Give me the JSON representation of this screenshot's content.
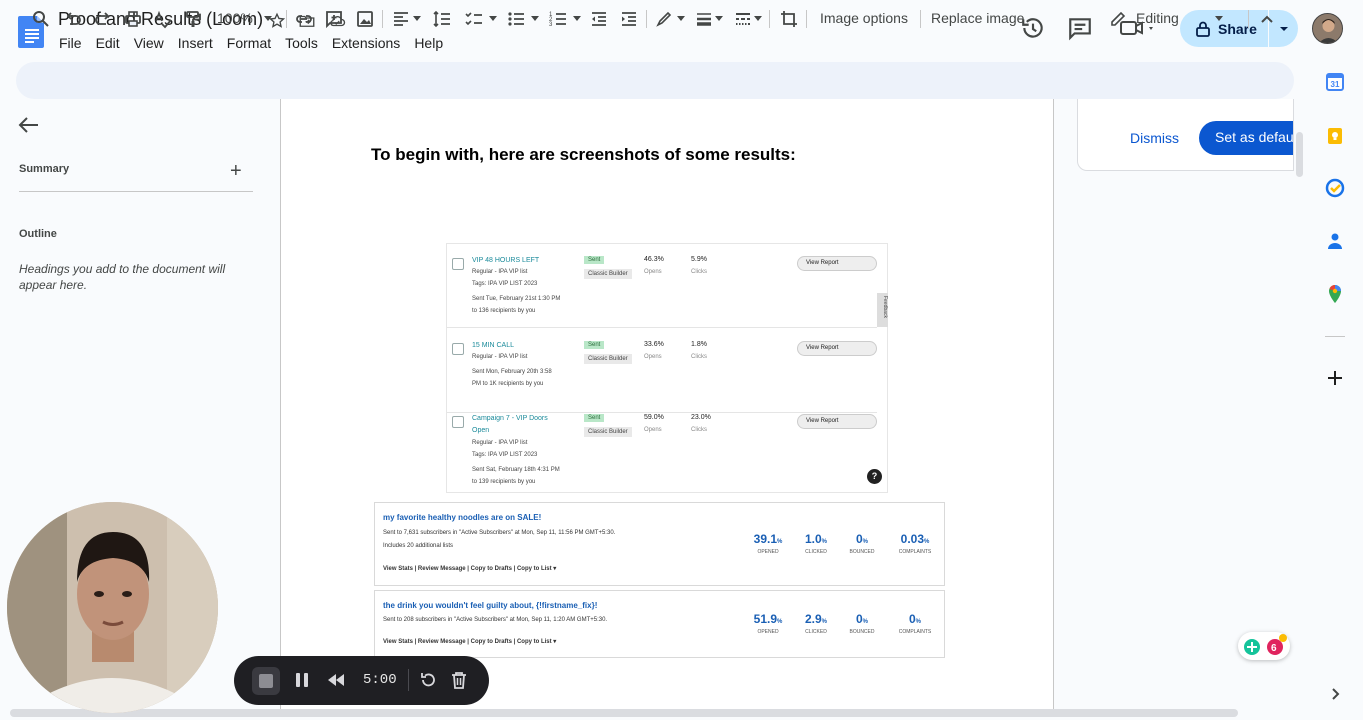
{
  "window": {
    "doc_title": "Proof and Results (Loom)"
  },
  "menu": [
    "File",
    "Edit",
    "View",
    "Insert",
    "Format",
    "Tools",
    "Extensions",
    "Help"
  ],
  "header": {
    "share_label": "Share"
  },
  "toolbar": {
    "zoom": "100%",
    "image_options_label": "Image options",
    "replace_image_label": "Replace image",
    "mode_label": "Editing"
  },
  "left_panel": {
    "summary_label": "Summary",
    "outline_label": "Outline",
    "outline_hint": "Headings you add to the document will appear here."
  },
  "document": {
    "heading": "To begin with, here are screenshots of some results:"
  },
  "campaign_report": {
    "campaigns": [
      {
        "title": "VIP 48 HOURS LEFT",
        "lines": [
          "Regular - IPA VIP list",
          "Tags: IPA VIP LIST 2023",
          "Sent Tue, February 21st 1:30 PM",
          "to 136 recipients by you"
        ],
        "status": "Sent",
        "builder": "Classic Builder",
        "opens": "46.3%",
        "opens_label": "Opens",
        "clicks": "5.9%",
        "clicks_label": "Clicks",
        "button": "View Report"
      },
      {
        "title": "15 MIN CALL",
        "lines": [
          "Regular - IPA VIP list",
          "Sent Mon, February 20th 3:58",
          "PM to 1K recipients by you"
        ],
        "status": "Sent",
        "builder": "Classic Builder",
        "opens": "33.6%",
        "opens_label": "Opens",
        "clicks": "1.8%",
        "clicks_label": "Clicks",
        "button": "View Report"
      },
      {
        "title": "Campaign 7 - VIP Doors",
        "title2": "Open",
        "lines": [
          "Regular - IPA VIP list",
          "Tags: IPA VIP LIST 2023",
          "Sent Sat, February 18th 4:31 PM",
          "to 139 recipients by you"
        ],
        "status": "Sent",
        "builder": "Classic Builder",
        "opens": "59.0%",
        "opens_label": "Opens",
        "clicks": "23.0%",
        "clicks_label": "Clicks",
        "button": "View Report"
      }
    ],
    "feedback_label": "Feedback",
    "help_symbol": "?"
  },
  "mail_stats": [
    {
      "subject": "my favorite healthy noodles are on SALE!",
      "sent_line": "Sent to 7,631 subscribers in \"Active Subscribers\" at Mon, Sep 11, 11:56 PM GMT+5:30.",
      "includes_line": "Includes 20 additional lists",
      "links": "View Stats  |  Review Message  |  Copy to Drafts  |  Copy to List ▾",
      "stats": [
        {
          "value": "39.1",
          "unit": "%",
          "label": "OPENED"
        },
        {
          "value": "1.0",
          "unit": "%",
          "label": "CLICKED"
        },
        {
          "value": "0",
          "unit": "%",
          "label": "BOUNCED"
        },
        {
          "value": "0.03",
          "unit": "%",
          "label": "COMPLAINTS"
        }
      ]
    },
    {
      "subject": "the drink you wouldn't feel guilty about, {!firstname_fix}!",
      "sent_line": "Sent to 208 subscribers in \"Active Subscribers\" at Mon, Sep 11, 1:20 AM GMT+5:30.",
      "links": "View Stats  |  Review Message  |  Copy to Drafts  |  Copy to List ▾",
      "stats": [
        {
          "value": "51.9",
          "unit": "%",
          "label": "OPENED"
        },
        {
          "value": "2.9",
          "unit": "%",
          "label": "CLICKED"
        },
        {
          "value": "0",
          "unit": "%",
          "label": "BOUNCED"
        },
        {
          "value": "0",
          "unit": "%",
          "label": "COMPLAINTS"
        }
      ]
    }
  ],
  "side_card": {
    "dismiss_label": "Dismiss",
    "set_default_label": "Set as default"
  },
  "loom": {
    "timer": "5:00"
  },
  "colors": {
    "accent": "#0b57d0",
    "share_bg": "#c2e7ff",
    "toolbar_bg": "#edf2fa"
  }
}
